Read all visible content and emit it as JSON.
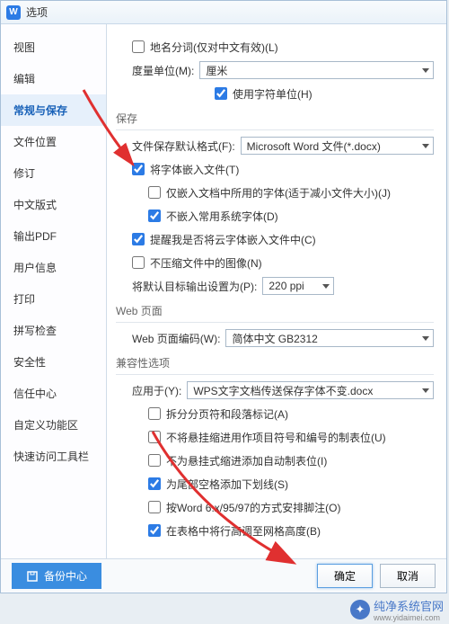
{
  "titlebar": {
    "logo": "W",
    "title": "选项"
  },
  "sidebar": {
    "items": [
      {
        "label": "视图"
      },
      {
        "label": "编辑"
      },
      {
        "label": "常规与保存"
      },
      {
        "label": "文件位置"
      },
      {
        "label": "修订"
      },
      {
        "label": "中文版式"
      },
      {
        "label": "输出PDF"
      },
      {
        "label": "用户信息"
      },
      {
        "label": "打印"
      },
      {
        "label": "拼写检查"
      },
      {
        "label": "安全性"
      },
      {
        "label": "信任中心"
      },
      {
        "label": "自定义功能区"
      },
      {
        "label": "快速访问工具栏"
      }
    ],
    "active_index": 2
  },
  "main": {
    "place_name_split": "地名分词(仅对中文有效)(L)",
    "unit_label": "度量单位(M):",
    "unit_value": "厘米",
    "use_char_unit": "使用字符单位(H)",
    "section_save": "保存",
    "save_format_label": "文件保存默认格式(F):",
    "save_format_value": "Microsoft Word 文件(*.docx)",
    "embed_font": "将字体嵌入文件(T)",
    "embed_only_used": "仅嵌入文档中所用的字体(适于减小文件大小)(J)",
    "no_embed_common": "不嵌入常用系统字体(D)",
    "remind_cloud": "提醒我是否将云字体嵌入文件中(C)",
    "no_compress_img": "不压缩文件中的图像(N)",
    "default_output_label": "将默认目标输出设置为(P):",
    "default_output_value": "220 ppi",
    "section_web": "Web 页面",
    "web_encoding_label": "Web 页面编码(W):",
    "web_encoding_value": "简体中文 GB2312",
    "section_compat": "兼容性选项",
    "apply_to_label": "应用于(Y):",
    "apply_to_value": "WPS文字文档传送保存字体不变.docx",
    "compat": [
      {
        "label": "拆分分页符和段落标记(A)",
        "checked": false
      },
      {
        "label": "不将悬挂缩进用作项目符号和编号的制表位(U)",
        "checked": false
      },
      {
        "label": "不为悬挂式缩进添加自动制表位(I)",
        "checked": false
      },
      {
        "label": "为尾部空格添加下划线(S)",
        "checked": true
      },
      {
        "label": "按Word 6.x/95/97的方式安排脚注(O)",
        "checked": false
      },
      {
        "label": "在表格中将行高调至网格高度(B)",
        "checked": true
      }
    ]
  },
  "footer": {
    "backup": "备份中心",
    "ok": "确定",
    "cancel": "取消"
  },
  "watermark": {
    "brand": "纯净系统官网",
    "url": "www.yidaimei.com"
  }
}
